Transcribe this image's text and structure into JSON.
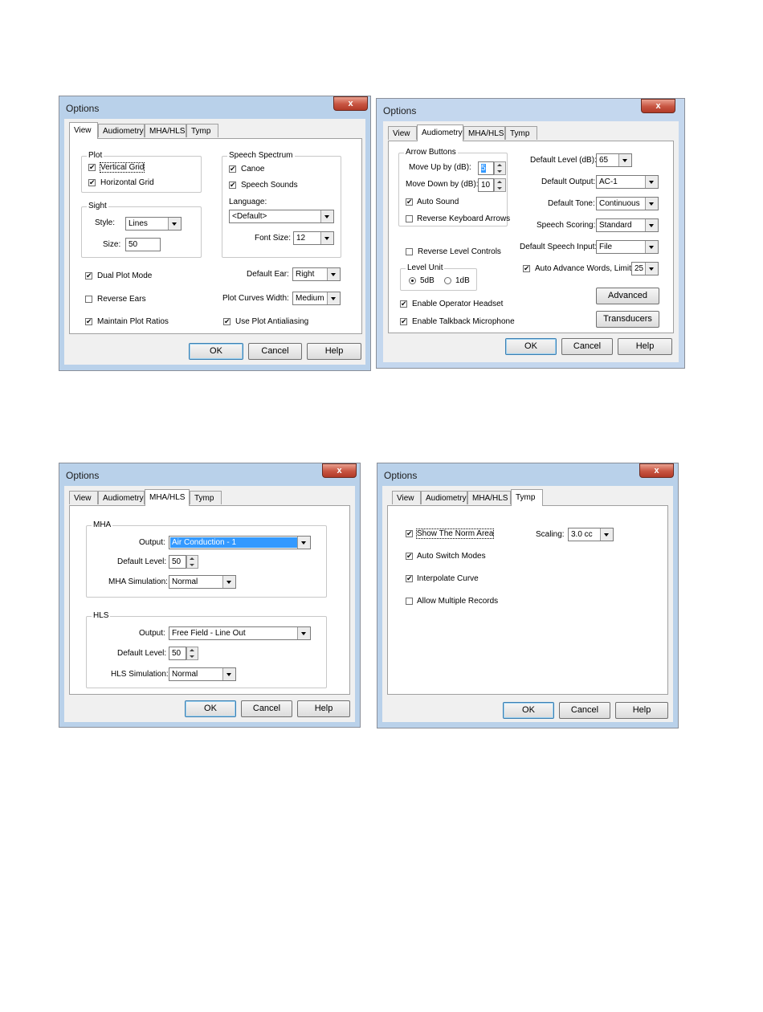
{
  "tabs": [
    "View",
    "Audiometry",
    "MHA/HLS",
    "Tymp"
  ],
  "dialog_title": "Options",
  "close_glyph": "x",
  "buttons": {
    "ok": "OK",
    "cancel": "Cancel",
    "help": "Help"
  },
  "view_tab": {
    "plot": {
      "label": "Plot",
      "vertical_grid": "Vertical Grid",
      "horizontal_grid": "Horizontal Grid"
    },
    "sight": {
      "label": "Sight",
      "style_label": "Style:",
      "style_value": "Lines",
      "size_label": "Size:",
      "size_value": "50"
    },
    "speech_spectrum": {
      "label": "Speech Spectrum",
      "canoe": "Canoe",
      "speech_sounds": "Speech Sounds",
      "language_label": "Language:",
      "language_value": "<Default>",
      "font_size_label": "Font Size:",
      "font_size_value": "12"
    },
    "dual_plot_mode": "Dual Plot Mode",
    "reverse_ears": "Reverse Ears",
    "maintain_plot_ratios": "Maintain Plot Ratios",
    "default_ear_label": "Default Ear:",
    "default_ear_value": "Right",
    "plot_curves_width_label": "Plot Curves Width:",
    "plot_curves_width_value": "Medium",
    "use_plot_antialiasing": "Use Plot Antialiasing"
  },
  "audiometry_tab": {
    "arrow_buttons": {
      "label": "Arrow Buttons",
      "move_up_label": "Move Up by (dB):",
      "move_up_value": "5",
      "move_down_label": "Move Down by (dB):",
      "move_down_value": "10",
      "auto_sound": "Auto Sound",
      "reverse_keyboard_arrows": "Reverse Keyboard Arrows"
    },
    "reverse_level_controls": "Reverse Level Controls",
    "level_unit": {
      "label": "Level Unit",
      "opt1": "5dB",
      "opt2": "1dB"
    },
    "enable_operator_headset": "Enable Operator Headset",
    "enable_talkback_microphone": "Enable Talkback Microphone",
    "default_level_label": "Default Level (dB):",
    "default_level_value": "65",
    "default_output_label": "Default Output:",
    "default_output_value": "AC-1",
    "default_tone_label": "Default Tone:",
    "default_tone_value": "Continuous",
    "speech_scoring_label": "Speech Scoring:",
    "speech_scoring_value": "Standard",
    "default_speech_input_label": "Default Speech Input:",
    "default_speech_input_value": "File",
    "auto_advance_label": "Auto Advance Words, Limit:",
    "auto_advance_value": "25",
    "advanced_button": "Advanced",
    "transducers_button": "Transducers"
  },
  "mha_tab": {
    "mha": {
      "label": "MHA",
      "output_label": "Output:",
      "output_value": "Air Conduction - 1",
      "level_label": "Default Level:",
      "level_value": "50",
      "sim_label": "MHA Simulation:",
      "sim_value": "Normal"
    },
    "hls": {
      "label": "HLS",
      "output_label": "Output:",
      "output_value": "Free Field - Line Out",
      "level_label": "Default Level:",
      "level_value": "50",
      "sim_label": "HLS Simulation:",
      "sim_value": "Normal"
    }
  },
  "tymp_tab": {
    "show_norm_area": "Show The Norm Area",
    "auto_switch_modes": "Auto Switch Modes",
    "interpolate_curve": "Interpolate Curve",
    "allow_multiple_records": "Allow Multiple Records",
    "scaling_label": "Scaling:",
    "scaling_value": "3.0 cc"
  }
}
